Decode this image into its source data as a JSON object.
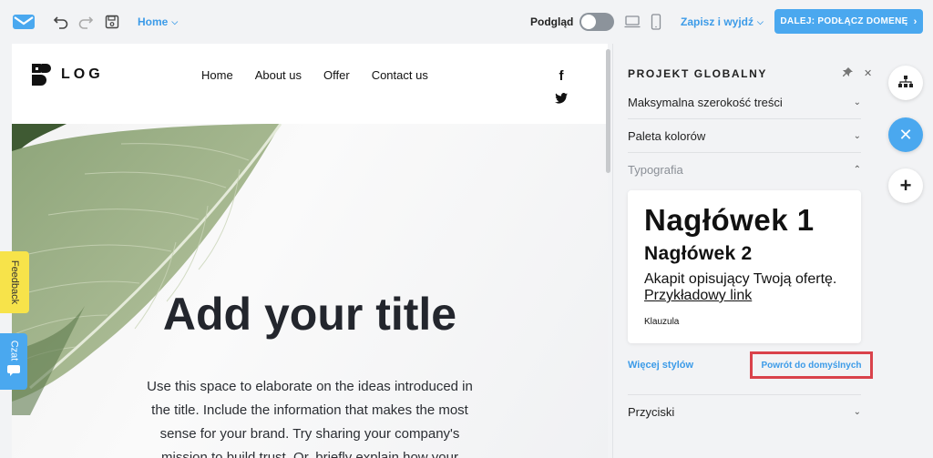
{
  "topbar": {
    "home_label": "Home",
    "preview_label": "Podgląd",
    "save_exit_label": "Zapisz i wyjdź",
    "next_label": "DALEJ: PODŁĄCZ DOMENĘ"
  },
  "site": {
    "logo_text": "LOG",
    "nav": [
      "Home",
      "About us",
      "Offer",
      "Contact us"
    ],
    "social": [
      "f",
      "𝕥"
    ],
    "hero_title": "Add your title",
    "hero_text": "Use this space to elaborate on the ideas introduced in the title. Include the information that makes the most sense for your brand. Try sharing your company's mission to build trust. Or, briefly explain how your"
  },
  "tabs": {
    "feedback": "Feedback",
    "chat": "Czat"
  },
  "panel": {
    "title": "PROJEKT GLOBALNY",
    "sections": [
      {
        "label": "Maksymalna szerokość treści"
      },
      {
        "label": "Paleta kolorów"
      },
      {
        "label": "Typografia"
      },
      {
        "label": "Przyciski"
      }
    ],
    "typography": {
      "h1": "Nagłówek 1",
      "h2": "Nagłówek 2",
      "paragraph": "Akapit opisujący Twoją ofertę.",
      "link": "Przykładowy link",
      "clause": "Klauzula"
    },
    "more_styles": "Więcej stylów",
    "reset_default": "Powrót do domyślnych"
  },
  "colors": {
    "accent": "#4aa8ef",
    "link": "#3c9be8",
    "highlight_border": "#d9424b",
    "feedback_tab": "#f7e34a"
  }
}
